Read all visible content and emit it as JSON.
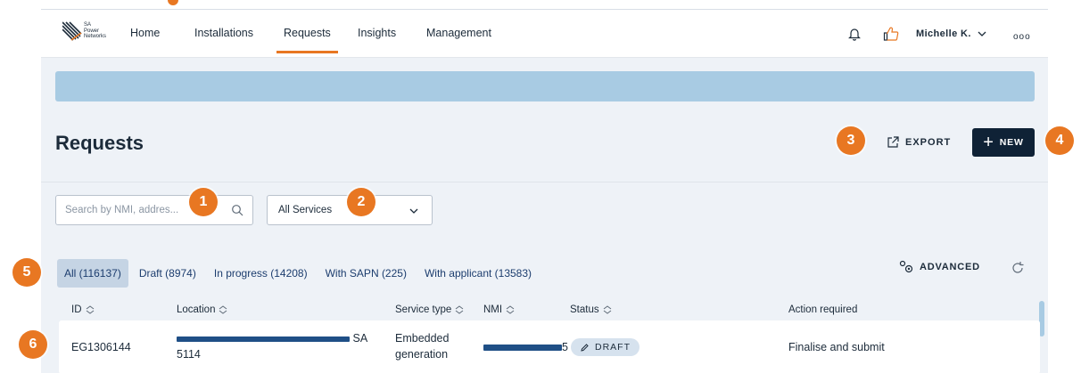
{
  "logo": {
    "brand_lines": [
      "SA",
      "Power",
      "Networks"
    ]
  },
  "nav": {
    "items": [
      {
        "label": "Home"
      },
      {
        "label": "Installations"
      },
      {
        "label": "Requests"
      },
      {
        "label": "Insights"
      },
      {
        "label": "Management"
      }
    ],
    "active": "Requests",
    "user_name": "Michelle K.",
    "more": "ooo"
  },
  "page": {
    "title": "Requests"
  },
  "toolbar": {
    "export_label": "EXPORT",
    "new_label": "NEW",
    "new_plus": "+"
  },
  "filters": {
    "search_placeholder": "Search by NMI, addres...",
    "service_selected": "All Services"
  },
  "tabs": [
    {
      "label": "All (116137)",
      "active": true
    },
    {
      "label": "Draft (8974)"
    },
    {
      "label": "In progress (14208)"
    },
    {
      "label": "With SAPN (225)"
    },
    {
      "label": "With applicant (13583)"
    }
  ],
  "advanced_label": "ADVANCED",
  "table": {
    "columns": [
      "ID",
      "Location",
      "Service type",
      "NMI",
      "Status",
      "Action required"
    ],
    "rows": [
      {
        "id": "EG1306144",
        "location_suffix_1": "SA",
        "location_suffix_2": "5114",
        "service_type_1": "Embedded",
        "service_type_2": "generation",
        "nmi_suffix": "5",
        "status": "DRAFT",
        "action": "Finalise and submit"
      }
    ]
  },
  "callouts": [
    "1",
    "2",
    "3",
    "4",
    "5",
    "6"
  ],
  "colors": {
    "accent": "#e87722",
    "navy": "#0f2236",
    "banner": "#a8cbe3",
    "tab_active": "#c5d4e4",
    "redaction": "#1f4f86"
  }
}
